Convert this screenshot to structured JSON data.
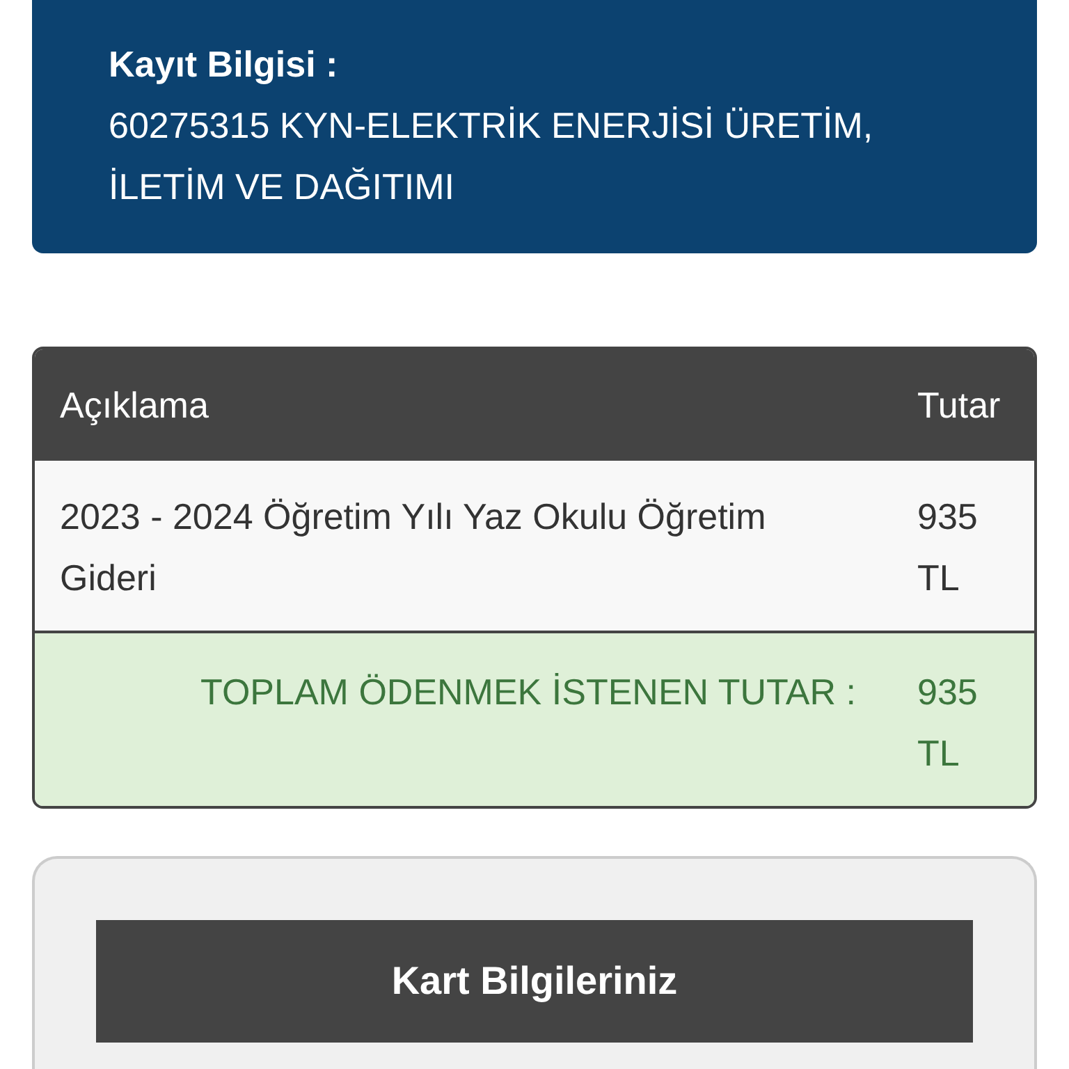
{
  "registration": {
    "label": "Kayıt Bilgisi :",
    "value": "60275315 KYN-ELEKTRİK ENERJİSİ ÜRETİM, İLETİM VE DAĞITIMI"
  },
  "table": {
    "columns": [
      "Açıklama",
      "Tutar"
    ],
    "rows": [
      {
        "description": "2023 - 2024 Öğretim Yılı Yaz Okulu Öğretim Gideri",
        "amount": "935 TL"
      }
    ],
    "total": {
      "label": "TOPLAM ÖDENMEK İSTENEN TUTAR :",
      "amount": "935 TL"
    }
  },
  "card_section": {
    "title": "Kart Bilgileriniz"
  }
}
